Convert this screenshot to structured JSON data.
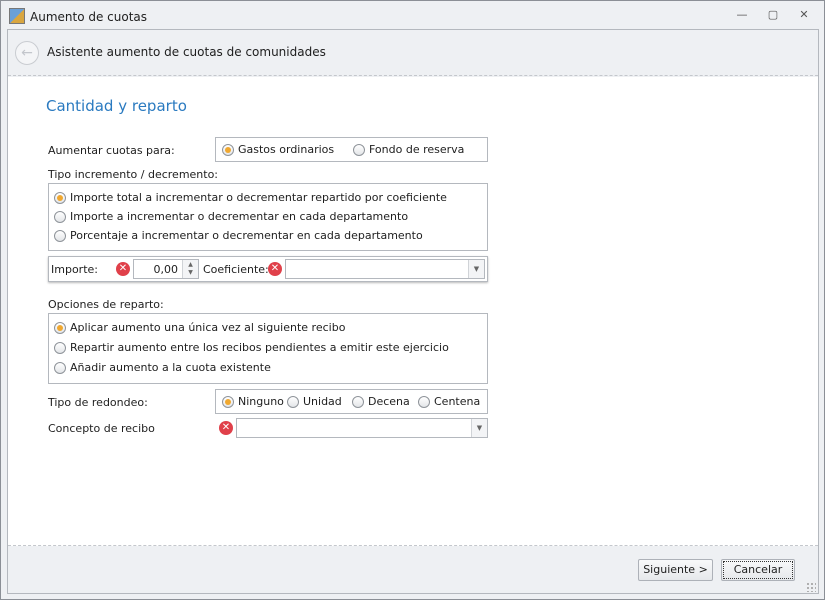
{
  "window": {
    "title": "Aumento de cuotas",
    "minimize": "—",
    "maximize": "▢",
    "close": "✕"
  },
  "wizard": {
    "title": "Asistente aumento de cuotas de comunidades",
    "back": "←"
  },
  "page": {
    "section_title": "Cantidad y reparto",
    "aumentar": {
      "label": "Aumentar cuotas para:",
      "options": [
        "Gastos ordinarios",
        "Fondo de reserva"
      ],
      "selected": 0
    },
    "tipo": {
      "label": "Tipo incremento / decremento:",
      "options": [
        "Importe total a incrementar o decrementar repartido por coeficiente",
        "Importe a incrementar o decrementar en cada departamento",
        "Porcentaje a incrementar o decrementar en cada departamento"
      ],
      "selected": 0
    },
    "importe": {
      "label": "Importe:",
      "value": "0,00",
      "coef_label": "Coeficiente:",
      "coef_value": ""
    },
    "opciones": {
      "label": "Opciones de reparto:",
      "options": [
        "Aplicar aumento una única vez al siguiente recibo",
        "Repartir aumento entre los recibos pendientes a emitir este ejercicio",
        "Añadir aumento a la cuota existente"
      ],
      "selected": 0
    },
    "redondeo": {
      "label": "Tipo de redondeo:",
      "options": [
        "Ninguno",
        "Unidad",
        "Decena",
        "Centena"
      ],
      "selected": 0
    },
    "concepto": {
      "label": "Concepto de recibo",
      "value": ""
    }
  },
  "buttons": {
    "next": "Siguiente >",
    "cancel": "Cancelar"
  }
}
